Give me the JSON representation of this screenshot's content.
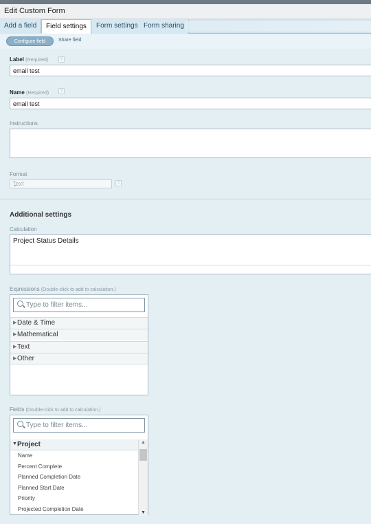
{
  "window": {
    "title": "Edit Custom Form"
  },
  "tabs": [
    {
      "label": "Add a field"
    },
    {
      "label": "Field settings"
    },
    {
      "label": "Form settings"
    },
    {
      "label": "Form sharing"
    }
  ],
  "subtabs": {
    "configure": "Configure field",
    "share": "Share field"
  },
  "label_field": {
    "label": "Label",
    "required": "(Required)",
    "value": "email test"
  },
  "name_field": {
    "label": "Name",
    "required": "(Required)",
    "value": "email test"
  },
  "instructions": {
    "label": "Instructions",
    "value": ""
  },
  "format": {
    "label": "Format",
    "value": "Text"
  },
  "help_glyph": "?",
  "additional": {
    "title": "Additional settings"
  },
  "calculation": {
    "label": "Calculation",
    "value": "Project Status Details"
  },
  "expressions": {
    "label": "Expressions",
    "hint": "(Double-click to add to calculation.)",
    "placeholder": "Type to filter items...",
    "items": [
      "Date & Time",
      "Mathematical",
      "Text",
      "Other"
    ]
  },
  "fields": {
    "label": "Fields",
    "hint": "(Double-click to add to calculation.)",
    "placeholder": "Type to filter items...",
    "group": "Project",
    "items": [
      "Name",
      "Percent Complete",
      "Planned Completion Date",
      "Planned Start Date",
      "Priority",
      "Projected Completion Date"
    ]
  },
  "icons": {
    "collapsed": "triangle-right-icon",
    "expanded": "triangle-down-icon",
    "search": "search-icon",
    "dropdown": "chevron-down-icon"
  }
}
